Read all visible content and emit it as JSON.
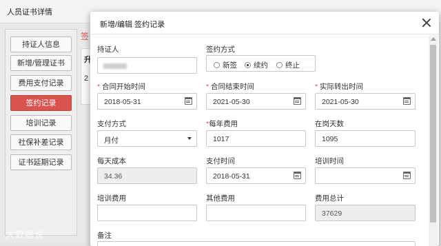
{
  "page": {
    "title": "人员证书详情"
  },
  "sidebar": {
    "items": [
      {
        "label": "持证人信息",
        "active": false
      },
      {
        "label": "新增/管理证书",
        "active": false
      },
      {
        "label": "费用支付记录",
        "active": false
      },
      {
        "label": "签约记录",
        "active": true
      },
      {
        "label": "培训记录",
        "active": false
      },
      {
        "label": "社保补差记录",
        "active": false
      },
      {
        "label": "证书延期记录",
        "active": false
      }
    ]
  },
  "background": {
    "tab_fragment": "签",
    "th_fragment": "升",
    "td_fragment": "2"
  },
  "watermark": "大数据说",
  "modal": {
    "title": "新增/编辑 签约记录",
    "fields": {
      "holder": {
        "label": "持证人"
      },
      "sign_method": {
        "label": "签约方式",
        "options": [
          "新签",
          "续约",
          "终止"
        ],
        "selected": "续约"
      },
      "contract_start": {
        "label": "合同开始时间",
        "value": "2018-05-31",
        "required": true
      },
      "contract_end": {
        "label": "合同结束时间",
        "value": "2021-05-30",
        "required": true
      },
      "actual_transfer": {
        "label": "实际转出时间",
        "value": "2021-05-30",
        "required": true
      },
      "pay_method": {
        "label": "支付方式",
        "value": "月付"
      },
      "annual_fee": {
        "label": "每年费用",
        "value": "1017",
        "required": true
      },
      "days_on_job": {
        "label": "在岗天数",
        "value": "1095"
      },
      "daily_cost": {
        "label": "每天成本",
        "value": "34.36"
      },
      "pay_time": {
        "label": "支付时间",
        "value": "2018-05-31"
      },
      "training_time": {
        "label": "培训时间",
        "value": ""
      },
      "training_fee": {
        "label": "培训费用",
        "value": ""
      },
      "other_fee": {
        "label": "其他费用",
        "value": ""
      },
      "total_fee": {
        "label": "费用总计",
        "value": "37629"
      },
      "remark": {
        "label": "备注"
      }
    }
  },
  "colors": {
    "active_sidebar": "#d9534f",
    "required_mark": "#d9534f"
  },
  "icons": [
    "calendar-icon",
    "close-icon",
    "chevron-down-icon"
  ]
}
